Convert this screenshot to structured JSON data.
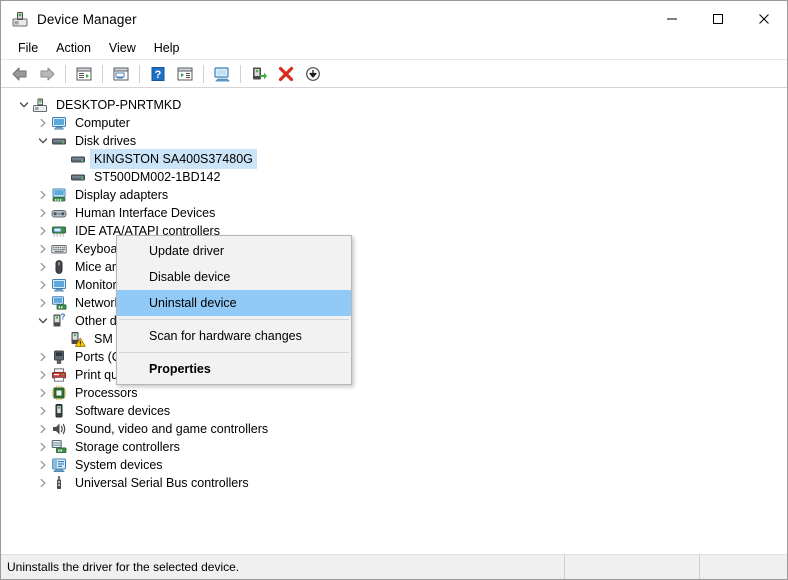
{
  "window": {
    "title": "Device Manager",
    "icon": "device-manager-icon",
    "controls": {
      "minimize": "─",
      "maximize": "☐",
      "close": "✕"
    }
  },
  "menubar": {
    "items": [
      {
        "label": "File"
      },
      {
        "label": "Action"
      },
      {
        "label": "View"
      },
      {
        "label": "Help"
      }
    ]
  },
  "toolbar": {
    "buttons": [
      {
        "name": "back-button",
        "icon": "back-arrow-icon"
      },
      {
        "name": "forward-button",
        "icon": "forward-arrow-icon"
      },
      {
        "name": "separator",
        "icon": "separator"
      },
      {
        "name": "properties-button",
        "icon": "properties-window-icon"
      },
      {
        "name": "separator",
        "icon": "separator"
      },
      {
        "name": "show-hidden-button",
        "icon": "list-window-icon"
      },
      {
        "name": "separator",
        "icon": "separator"
      },
      {
        "name": "help-button",
        "icon": "help-question-icon"
      },
      {
        "name": "update-driver-button",
        "icon": "update-driver-icon"
      },
      {
        "name": "separator",
        "icon": "separator"
      },
      {
        "name": "scan-hardware-button",
        "icon": "scan-monitor-icon"
      },
      {
        "name": "separator",
        "icon": "separator"
      },
      {
        "name": "enable-device-button",
        "icon": "enable-device-icon"
      },
      {
        "name": "uninstall-device-button",
        "icon": "red-x-icon"
      },
      {
        "name": "disable-device-button",
        "icon": "down-arrow-circle-icon"
      }
    ]
  },
  "tree": {
    "root": {
      "label": "DESKTOP-PNRTMKD",
      "icon": "computer-root-icon",
      "expanded": true,
      "indent": 0
    },
    "nodes": [
      {
        "label": "Computer",
        "icon": "monitor-icon",
        "expandable": true,
        "expanded": false,
        "indent": 1
      },
      {
        "label": "Disk drives",
        "icon": "disk-drive-icon",
        "expandable": true,
        "expanded": true,
        "indent": 1
      },
      {
        "label": "KINGSTON SA400S37480G",
        "icon": "disk-drive-icon",
        "expandable": false,
        "indent": 2,
        "selected": true
      },
      {
        "label": "ST500DM002-1BD142",
        "icon": "disk-drive-icon",
        "expandable": false,
        "indent": 2
      },
      {
        "label": "Display adapters",
        "icon": "display-adapter-icon",
        "expandable": true,
        "expanded": false,
        "indent": 1
      },
      {
        "label": "Human Interface Devices",
        "icon": "hid-icon",
        "expandable": true,
        "expanded": false,
        "indent": 1
      },
      {
        "label": "IDE ATA/ATAPI controllers",
        "icon": "ide-controller-icon",
        "expandable": true,
        "expanded": false,
        "indent": 1
      },
      {
        "label": "Keyboards",
        "icon": "keyboard-icon",
        "expandable": true,
        "expanded": false,
        "indent": 1
      },
      {
        "label": "Mice and other pointing devices",
        "icon": "mouse-icon",
        "expandable": true,
        "expanded": false,
        "indent": 1
      },
      {
        "label": "Monitors",
        "icon": "monitor-icon",
        "expandable": true,
        "expanded": false,
        "indent": 1
      },
      {
        "label": "Network adapters",
        "icon": "network-adapter-icon",
        "expandable": true,
        "expanded": false,
        "indent": 1
      },
      {
        "label": "Other devices",
        "icon": "other-devices-icon",
        "expandable": true,
        "expanded": true,
        "indent": 1
      },
      {
        "label": "SM Bus Controller",
        "icon": "unknown-device-warning-icon",
        "expandable": false,
        "indent": 2
      },
      {
        "label": "Ports (COM & LPT)",
        "icon": "port-icon",
        "expandable": true,
        "expanded": false,
        "indent": 1
      },
      {
        "label": "Print queues",
        "icon": "printer-icon",
        "expandable": true,
        "expanded": false,
        "indent": 1
      },
      {
        "label": "Processors",
        "icon": "processor-icon",
        "expandable": true,
        "expanded": false,
        "indent": 1
      },
      {
        "label": "Software devices",
        "icon": "software-device-icon",
        "expandable": true,
        "expanded": false,
        "indent": 1
      },
      {
        "label": "Sound, video and game controllers",
        "icon": "sound-icon",
        "expandable": true,
        "expanded": false,
        "indent": 1
      },
      {
        "label": "Storage controllers",
        "icon": "storage-controller-icon",
        "expandable": true,
        "expanded": false,
        "indent": 1
      },
      {
        "label": "System devices",
        "icon": "system-device-icon",
        "expandable": true,
        "expanded": false,
        "indent": 1
      },
      {
        "label": "Universal Serial Bus controllers",
        "icon": "usb-icon",
        "expandable": true,
        "expanded": false,
        "indent": 1
      }
    ]
  },
  "context_menu": {
    "items": [
      {
        "label": "Update driver",
        "type": "item"
      },
      {
        "label": "Disable device",
        "type": "item"
      },
      {
        "label": "Uninstall device",
        "type": "item",
        "highlighted": true
      },
      {
        "type": "separator"
      },
      {
        "label": "Scan for hardware changes",
        "type": "item"
      },
      {
        "type": "separator"
      },
      {
        "label": "Properties",
        "type": "item",
        "bold": true
      }
    ]
  },
  "statusbar": {
    "message": "Uninstalls the driver for the selected device."
  },
  "colors": {
    "selection": "#cce4f7",
    "menu_highlight": "#91c9f7",
    "menu_background": "#f2f2f2",
    "window_background": "#ffffff",
    "statusbar_background": "#f0f0f0",
    "warning": "#ffcc00",
    "uninstall_red": "#d92a1c"
  }
}
